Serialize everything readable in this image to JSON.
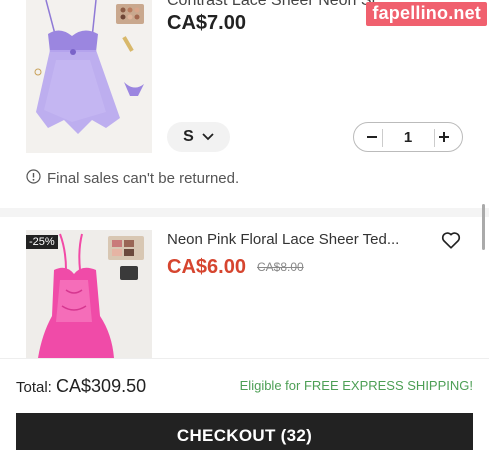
{
  "watermark": "fapellino.net",
  "item1": {
    "title": "Contrast Lace Sheer Neon Sl...",
    "price": "CA$7.00",
    "size": "S",
    "quantity": "1",
    "note": "Final sales can't be returned."
  },
  "item2": {
    "discount_badge": "-25%",
    "title": "Neon Pink Floral Lace Sheer Ted...",
    "price": "CA$6.00",
    "original_price": "CA$8.00"
  },
  "footer": {
    "total_label": "Total:",
    "total_amount": "CA$309.50",
    "shipping_note": "Eligible for FREE EXPRESS SHIPPING!",
    "checkout_label": "CHECKOUT (32)"
  },
  "colors": {
    "sale_red": "#d6452f",
    "shipping_green": "#4d9f55",
    "checkout_bg": "#222222",
    "watermark_bg": "#f0606e"
  },
  "icons": [
    "chevron-down-icon",
    "minus-icon",
    "plus-icon",
    "info-icon",
    "heart-icon"
  ]
}
